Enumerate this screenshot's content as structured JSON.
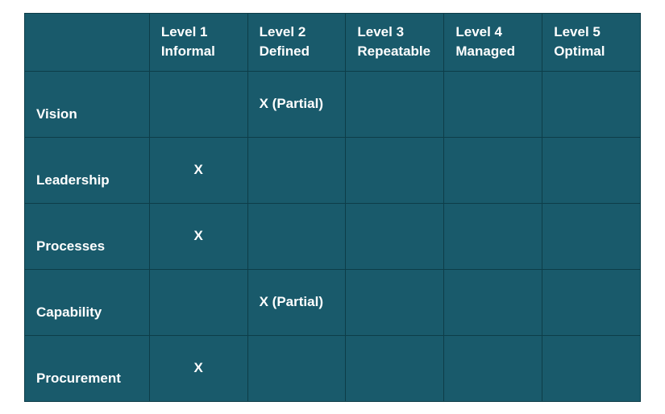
{
  "chart_data": {
    "type": "table",
    "title": "",
    "columns": [
      {
        "level": "Level 1",
        "name": "Informal"
      },
      {
        "level": "Level 2",
        "name": "Defined"
      },
      {
        "level": "Level 3",
        "name": "Repeatable"
      },
      {
        "level": "Level 4",
        "name": "Managed"
      },
      {
        "level": "Level 5",
        "name": "Optimal"
      }
    ],
    "rows": [
      {
        "label": "Vision",
        "cells": [
          "",
          "X (Partial)",
          "",
          "",
          ""
        ]
      },
      {
        "label": "Leadership",
        "cells": [
          "X",
          "",
          "",
          "",
          ""
        ]
      },
      {
        "label": "Processes",
        "cells": [
          "X",
          "",
          "",
          "",
          ""
        ]
      },
      {
        "label": "Capability",
        "cells": [
          "",
          "X (Partial)",
          "",
          "",
          ""
        ]
      },
      {
        "label": "Procurement",
        "cells": [
          "X",
          "",
          "",
          "",
          ""
        ]
      }
    ]
  }
}
